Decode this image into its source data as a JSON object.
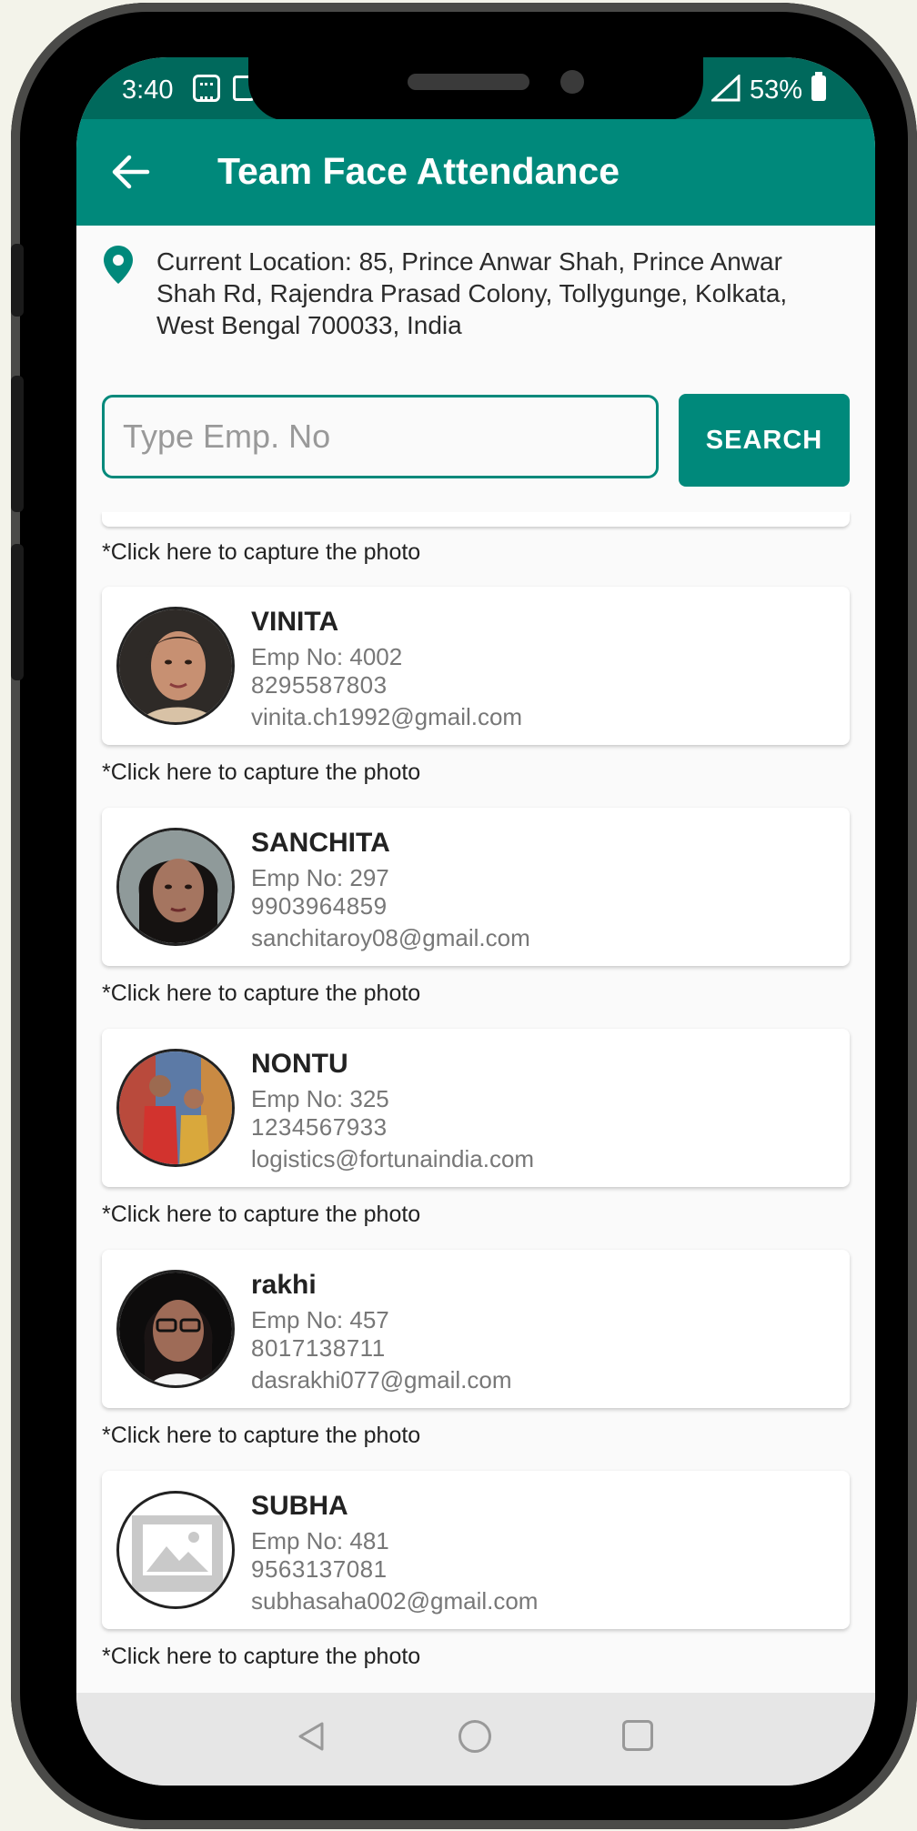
{
  "status_bar": {
    "time": "3:40",
    "battery": "53%"
  },
  "app_bar": {
    "title": "Team Face Attendance",
    "back_icon": "arrow-left-icon"
  },
  "location": {
    "icon": "map-pin-icon",
    "text": "Current Location: 85, Prince Anwar Shah, Prince Anwar Shah Rd, Rajendra Prasad Colony, Tollygunge, Kolkata, West Bengal 700033, India"
  },
  "search": {
    "placeholder": "Type Emp. No",
    "value": "",
    "button_label": "SEARCH"
  },
  "capture_hint": "*Click here to capture the photo",
  "employees": [
    {
      "name": "VINITA",
      "emp_no": "Emp No: 4002",
      "phone": "8295587803",
      "email": "vinita.ch1992@gmail.com"
    },
    {
      "name": "SANCHITA",
      "emp_no": "Emp No: 297",
      "phone": "9903964859",
      "email": "sanchitaroy08@gmail.com"
    },
    {
      "name": "NONTU",
      "emp_no": "Emp No: 325",
      "phone": "1234567933",
      "email": "logistics@fortunaindia.com"
    },
    {
      "name": "rakhi",
      "emp_no": "Emp No: 457",
      "phone": "8017138711",
      "email": "dasrakhi077@gmail.com"
    },
    {
      "name": "SUBHA",
      "emp_no": "Emp No: 481",
      "phone": "9563137081",
      "email": "subhasaha002@gmail.com"
    }
  ],
  "colors": {
    "primary": "#00897b",
    "primary_dark": "#00695c"
  },
  "nav_bar": {
    "back_icon": "triangle-back-icon",
    "home_icon": "circle-home-icon",
    "recent_icon": "square-recents-icon"
  }
}
